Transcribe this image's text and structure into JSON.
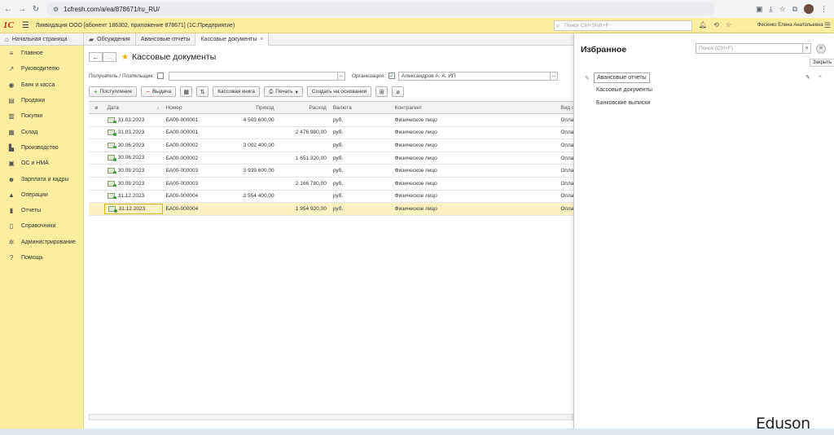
{
  "browser": {
    "url": "1cfresh.com/a/ea/878671/ru_RU/"
  },
  "app": {
    "title": "Ликвидация ООО [абонент 186302, приложение 878671]  (1С:Предприятие)",
    "search_placeholder": "Поиск Ctrl+Shift+F",
    "user": "Фесенко Елена Анатольевна",
    "logo": "1С"
  },
  "tabs": [
    {
      "label": "Начальная страница",
      "icon": "home-icon"
    },
    {
      "label": "Обсуждения",
      "icon": "chat-icon"
    },
    {
      "label": "Авансовые отчеты"
    },
    {
      "label": "Кассовые документы",
      "active": true
    }
  ],
  "sidebar": {
    "items": [
      {
        "label": "Главное",
        "icon": "menu-icon"
      },
      {
        "label": "Руководителю",
        "icon": "chart-icon"
      },
      {
        "label": "Банк и касса",
        "icon": "bank-icon"
      },
      {
        "label": "Продажи",
        "icon": "cart-icon"
      },
      {
        "label": "Покупки",
        "icon": "basket-icon"
      },
      {
        "label": "Склад",
        "icon": "warehouse-icon"
      },
      {
        "label": "Производство",
        "icon": "factory-icon"
      },
      {
        "label": "ОС и НМА",
        "icon": "assets-icon"
      },
      {
        "label": "Зарплата и кадры",
        "icon": "people-icon"
      },
      {
        "label": "Операции",
        "icon": "operations-icon"
      },
      {
        "label": "Отчеты",
        "icon": "report-icon"
      },
      {
        "label": "Справочники",
        "icon": "book-icon"
      },
      {
        "label": "Администрирование",
        "icon": "gear-icon"
      },
      {
        "label": "Помощь",
        "icon": "help-icon"
      }
    ]
  },
  "main": {
    "title": "Кассовые документы",
    "filter": {
      "payer_label": "Получатель / Плательщик:",
      "org_label": "Организация:",
      "org_value": "Александров А. А. ИП"
    },
    "toolbar": {
      "income": "Поступление",
      "expense": "Выдача",
      "cashbook": "Кассовая книга",
      "print": "Печать",
      "create_based": "Создать на основании"
    },
    "columns": [
      "Дата",
      "Номер",
      "Приход",
      "Расход",
      "Валюта",
      "Контрагент",
      "Вид о"
    ],
    "rows": [
      {
        "date": "31.03.2023",
        "number": "БА00-000001",
        "income": "4 503 600,00",
        "expense": "",
        "currency": "руб.",
        "counterparty": "Физическое лицо",
        "kind": "Опла"
      },
      {
        "date": "31.03.2023",
        "number": "БА00-000001",
        "income": "",
        "expense": "2 476 980,00",
        "currency": "руб.",
        "counterparty": "Физическое лицо",
        "kind": "Опла"
      },
      {
        "date": "30.06.2023",
        "number": "БА00-000002",
        "income": "3 002 400,00",
        "expense": "",
        "currency": "руб.",
        "counterparty": "Физическое лицо",
        "kind": "Опла"
      },
      {
        "date": "30.06.2023",
        "number": "БА00-000002",
        "income": "",
        "expense": "1 651 320,00",
        "currency": "руб.",
        "counterparty": "Физическое лицо",
        "kind": "Опла"
      },
      {
        "date": "30.09.2023",
        "number": "БА00-000003",
        "income": "3 939 600,00",
        "expense": "",
        "currency": "руб.",
        "counterparty": "Физическое лицо",
        "kind": "Опла"
      },
      {
        "date": "30.09.2023",
        "number": "БА00-000003",
        "income": "",
        "expense": "2 166 780,00",
        "currency": "руб.",
        "counterparty": "Физическое лицо",
        "kind": "Опла"
      },
      {
        "date": "31.12.2023",
        "number": "БА00-000004",
        "income": "3 554 400,00",
        "expense": "",
        "currency": "руб.",
        "counterparty": "Физическое лицо",
        "kind": "Опла"
      },
      {
        "date": "31.12.2023",
        "number": "БА00-000004",
        "income": "",
        "expense": "1 954 920,00",
        "currency": "руб.",
        "counterparty": "Физическое лицо",
        "kind": "Опла",
        "selected": true
      }
    ]
  },
  "favorites": {
    "title": "Избранное",
    "search_placeholder": "Поиск (Ctrl+F)",
    "close_tooltip": "Закрыть",
    "items": [
      "Авансовые отчеты",
      "Кассовые документы",
      "Банковские выписки"
    ]
  },
  "watermark": "Eduson"
}
